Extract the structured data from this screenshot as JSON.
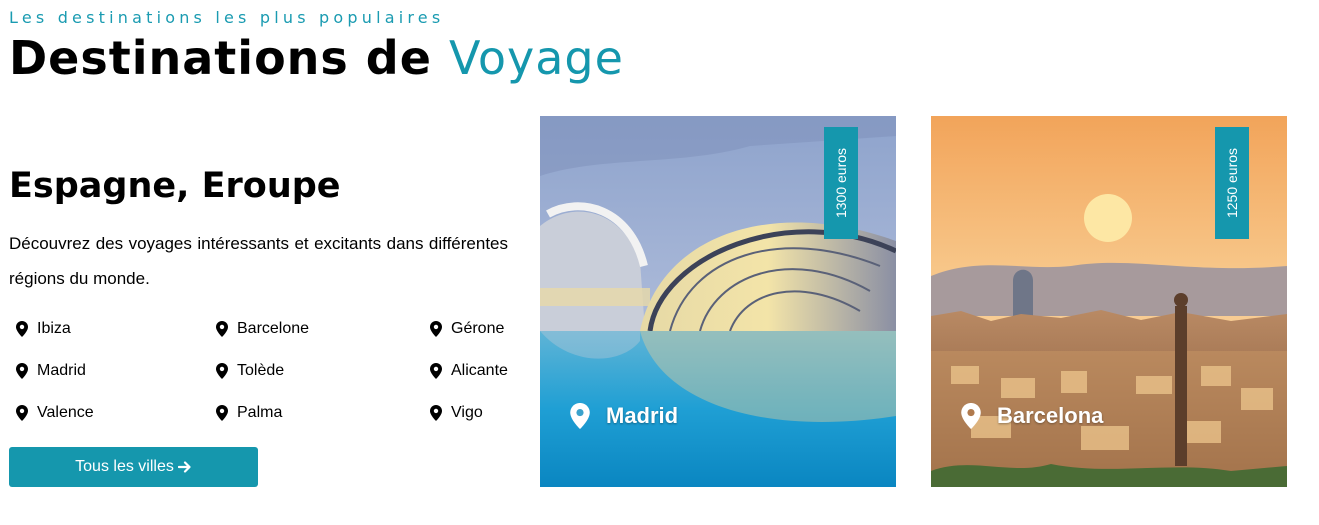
{
  "header": {
    "eyebrow": "Les destinations les plus populaires",
    "title_main": "Destinations de",
    "title_accent": "Voyage"
  },
  "intro": {
    "region_title": "Espagne, Eroupe",
    "description": "Découvrez des voyages intéressants et excitants dans différentes régions du monde."
  },
  "cities": {
    "col1": [
      "Ibiza",
      "Madrid",
      "Valence"
    ],
    "col2": [
      "Barcelone",
      "Tolède",
      "Palma"
    ],
    "col3": [
      "Gérone",
      "Alicante",
      "Vigo"
    ]
  },
  "cta": {
    "label": "Tous les villes",
    "icon": "arrow-right-icon"
  },
  "cards": [
    {
      "city": "Madrid",
      "price": "1300 euros",
      "icon": "map-pin-icon"
    },
    {
      "city": "Barcelona",
      "price": "1250 euros",
      "icon": "map-pin-icon"
    }
  ],
  "colors": {
    "accent": "#1597ad",
    "text": "#000000",
    "background": "#ffffff"
  }
}
